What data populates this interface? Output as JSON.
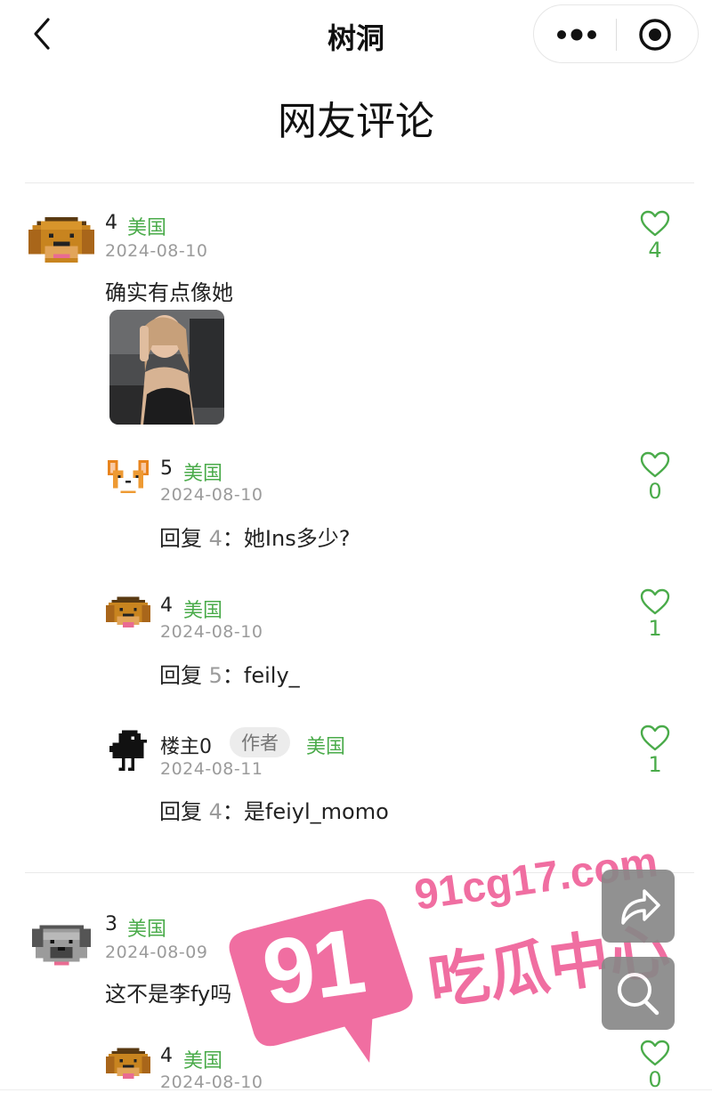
{
  "nav": {
    "title": "树洞",
    "back_icon": "chevron-left-icon",
    "more_icon": "more-dots-icon",
    "target_icon": "target-circle-icon"
  },
  "section": {
    "title": "网友评论"
  },
  "colors": {
    "location": "#4aab4a",
    "date": "#9b9b9b",
    "like": "#4aab4a",
    "accent_watermark": "#f06ea1"
  },
  "reply_prefix": "回复",
  "reply_sep": "：",
  "comments": [
    {
      "user": "4",
      "location": "美国",
      "date": "2024-08-10",
      "text": "确实有点像她",
      "likes": "4",
      "avatar": "dog-avatar",
      "has_photo": true,
      "replies": [
        {
          "user": "5",
          "location": "美国",
          "date": "2024-08-10",
          "reply_to": "4",
          "text": "她Ins多少?",
          "likes": "0",
          "avatar": "corgi-avatar"
        },
        {
          "user": "4",
          "location": "美国",
          "date": "2024-08-10",
          "reply_to": "5",
          "text": "feily_",
          "likes": "1",
          "avatar": "dog-avatar"
        },
        {
          "user": "楼主0",
          "badge": "作者",
          "location": "美国",
          "date": "2024-08-11",
          "reply_to": "4",
          "text": "是feiyl_momo",
          "likes": "1",
          "avatar": "bird-avatar"
        }
      ]
    },
    {
      "user": "3",
      "location": "美国",
      "date": "2024-08-09",
      "text": "这不是李fy吗",
      "likes": "",
      "avatar": "pug-avatar",
      "replies": [
        {
          "user": "4",
          "location": "美国",
          "date": "2024-08-10",
          "likes": "0",
          "avatar": "dog-avatar"
        }
      ]
    }
  ],
  "watermark": {
    "domain": "91cg17.com",
    "number": "91",
    "name": "吃瓜中心"
  },
  "fabs": {
    "share_icon": "share-arrow-icon",
    "search_icon": "search-icon"
  }
}
